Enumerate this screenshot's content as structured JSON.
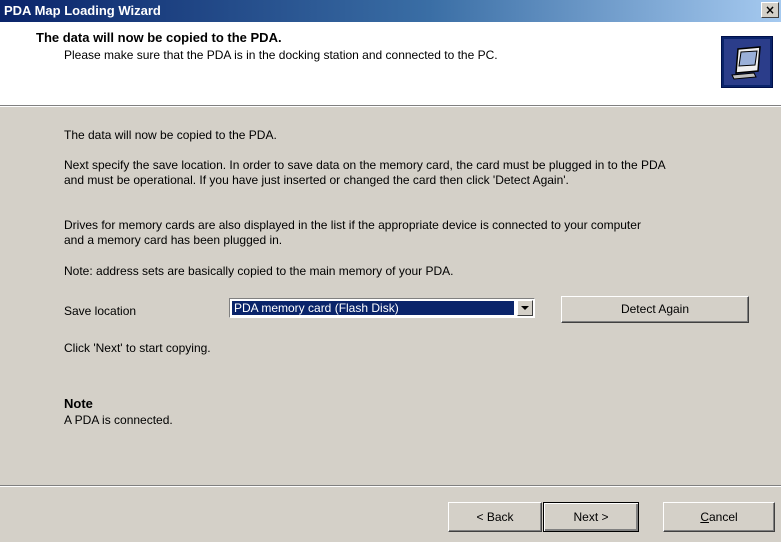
{
  "window": {
    "title": "PDA Map Loading Wizard",
    "close_glyph": "×"
  },
  "header": {
    "title": "The data will now be copied to the PDA.",
    "subtitle": "Please make sure that the PDA is in the docking station and connected to the PC.",
    "icon": "pda-icon"
  },
  "body": {
    "intro": "The data will now be copied to the PDA.",
    "para1_line1": "Next specify the save location. In order to save data on the memory card, the card must be plugged in to the PDA",
    "para1_line2": "and must be operational. If you have just inserted or changed the card then click 'Detect Again'.",
    "para2_line1": "Drives for memory cards are also displayed in the list if the appropriate device is connected to your computer",
    "para2_line2": "and a memory card has been plugged in.",
    "para3": "Note: address sets are basically copied to the main memory of your PDA.",
    "save_location_label": "Save location",
    "save_location_value": "PDA memory card (Flash Disk)",
    "detect_again_label": "Detect Again",
    "click_next": "Click 'Next' to start copying.",
    "note_title": "Note",
    "note_text": "A PDA is connected."
  },
  "footer": {
    "back_label": "< Back",
    "next_label": "Next >",
    "cancel_first": "C",
    "cancel_rest": "ancel"
  }
}
